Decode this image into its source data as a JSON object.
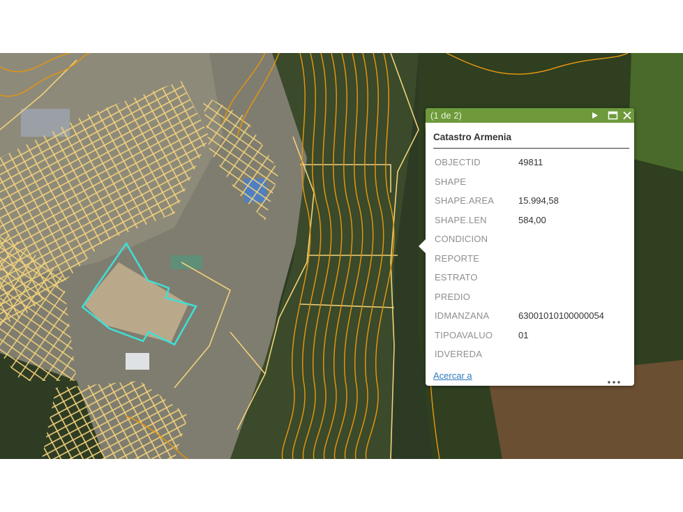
{
  "map": {
    "basemap": "satellite-imagery",
    "colors": {
      "contour": "#e3940f",
      "parcel": "#f2d27a",
      "selection": "#3fe0d6",
      "vegetation_dark": "#22301c",
      "urban": "#8d8a7c"
    }
  },
  "popup": {
    "counter": "(1 de 2)",
    "layer_title": "Catastro Armenia",
    "colors": {
      "header": "#6e9a3c",
      "link": "#2b78c0"
    },
    "icons": {
      "next": "play-icon",
      "maximize": "maximize-icon",
      "close": "close-icon",
      "more": "more-icon"
    },
    "attributes": [
      {
        "key": "OBJECTID",
        "value": "49811"
      },
      {
        "key": "SHAPE",
        "value": ""
      },
      {
        "key": "SHAPE.AREA",
        "value": "15.994,58"
      },
      {
        "key": "SHAPE.LEN",
        "value": "584,00"
      },
      {
        "key": "CONDICION",
        "value": ""
      },
      {
        "key": "REPORTE",
        "value": ""
      },
      {
        "key": "ESTRATO",
        "value": ""
      },
      {
        "key": "PREDIO",
        "value": ""
      },
      {
        "key": "IDMANZANA",
        "value": "63001010100000054"
      },
      {
        "key": "TIPOAVALUO",
        "value": "01"
      },
      {
        "key": "IDVEREDA",
        "value": ""
      }
    ],
    "zoom_link": "Acercar a"
  }
}
